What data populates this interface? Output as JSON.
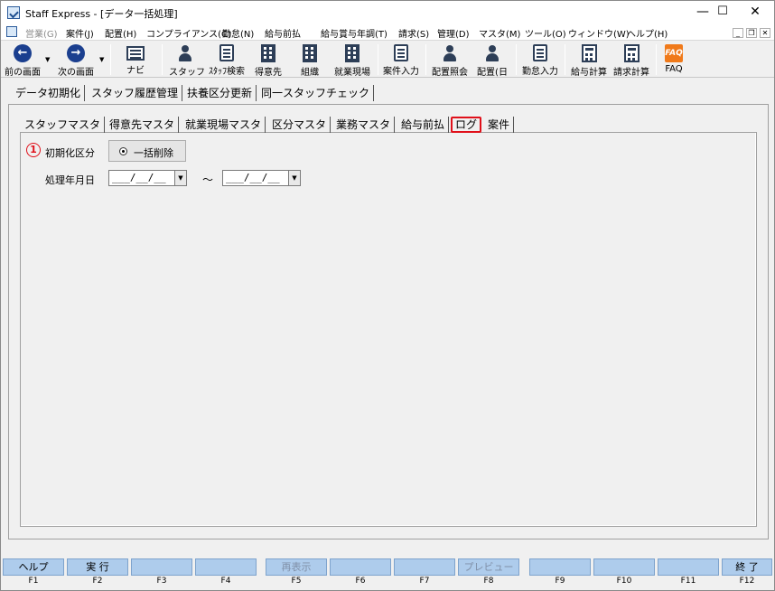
{
  "window": {
    "title": "Staff Express - [データ一括処理]",
    "controls": {
      "minimize": "—",
      "maximize": "☐",
      "close": "✕"
    }
  },
  "menu": {
    "items": [
      {
        "label": "営業(G)",
        "disabled": true
      },
      {
        "label": "案件(J)"
      },
      {
        "label": "配置(H)"
      },
      {
        "label": "コンプライアンス(C)"
      },
      {
        "label": "勤怠(N)"
      },
      {
        "label": "給与前払"
      },
      {
        "label": "給与賞与年調(T)"
      },
      {
        "label": "請求(S)"
      },
      {
        "label": "管理(D)"
      },
      {
        "label": "マスタ(M)"
      },
      {
        "label": "ツール(O)"
      },
      {
        "label": "ウィンドウ(W)"
      },
      {
        "label": "ヘルプ(H)"
      }
    ],
    "mdi": {
      "minimize": "_",
      "restore": "❐",
      "close": "✕"
    }
  },
  "toolbar": {
    "prev": "前の画面",
    "next": "次の画面",
    "navi": "ナビ",
    "staff": "スタッフ",
    "staff_search": "ｽﾀｯﾌ検索",
    "client": "得意先",
    "org": "組織",
    "workplace": "就業現場",
    "case_input": "案件入力",
    "assign_inquiry": "配置照会",
    "assign_day": "配置(日",
    "attendance_input": "勤怠入力",
    "payroll_calc": "給与計算",
    "billing_calc": "請求計算",
    "faq": "FAQ",
    "faq_icon": "FAQ"
  },
  "main_tabs": [
    "データ初期化",
    "スタッフ履歴管理",
    "扶養区分更新",
    "同一スタッフチェック"
  ],
  "sub_tabs": [
    "スタッフマスタ",
    "得意先マスタ",
    "就業現場マスタ",
    "区分マスタ",
    "業務マスタ",
    "給与前払",
    "ログ",
    "案件"
  ],
  "sub_tabs_active": "ログ",
  "form": {
    "step_marker": "1",
    "init_label": "初期化区分",
    "init_option": "一括削除",
    "date_label": "処理年月日",
    "date_from": "___/__/__",
    "date_to": "___/__/__",
    "range_sep": "〜"
  },
  "function_keys": [
    {
      "label": "ヘルプ",
      "key": "F1"
    },
    {
      "label": "実 行",
      "key": "F2"
    },
    {
      "label": "",
      "key": "F3"
    },
    {
      "label": "",
      "key": "F4"
    },
    {
      "label": "再表示",
      "key": "F5",
      "disabled": true
    },
    {
      "label": "",
      "key": "F6"
    },
    {
      "label": "",
      "key": "F7"
    },
    {
      "label": "プレビュー",
      "key": "F8",
      "disabled": true
    },
    {
      "label": "",
      "key": "F9"
    },
    {
      "label": "",
      "key": "F10"
    },
    {
      "label": "",
      "key": "F11"
    },
    {
      "label": "終 了",
      "key": "F12"
    }
  ],
  "colors": {
    "highlight": "#e0101a",
    "fkey_bg": "#aeccec",
    "faq_icon": "#f07a1a"
  }
}
